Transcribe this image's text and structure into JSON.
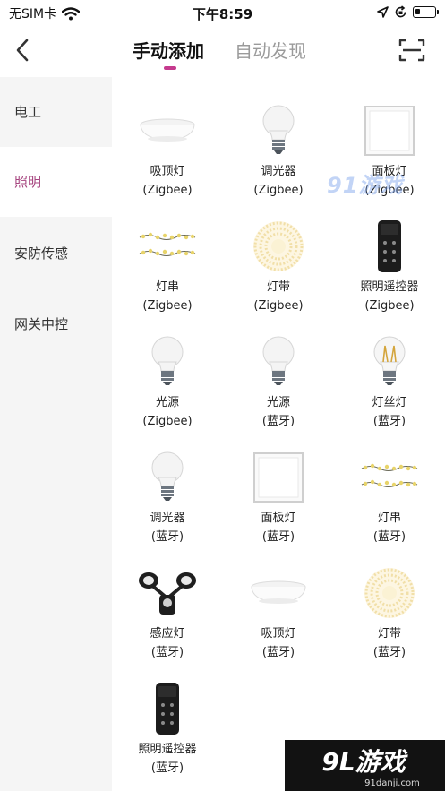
{
  "status_bar": {
    "carrier": "无SIM卡",
    "time": "下午8:59",
    "battery_level": 0.25
  },
  "nav": {
    "tabs": [
      {
        "label": "手动添加",
        "active": true
      },
      {
        "label": "自动发现",
        "active": false
      }
    ],
    "accent_color": "#c53a8e"
  },
  "sidebar": {
    "items": [
      {
        "label": "电工",
        "active": false
      },
      {
        "label": "照明",
        "active": true
      },
      {
        "label": "安防传感",
        "active": false
      },
      {
        "label": "网关中控",
        "active": false
      }
    ],
    "active_color": "#a6447f"
  },
  "devices": [
    {
      "name": "吸顶灯",
      "protocol": "(Zigbee)",
      "icon": "ceiling-light-icon"
    },
    {
      "name": "调光器",
      "protocol": "(Zigbee)",
      "icon": "bulb-icon"
    },
    {
      "name": "面板灯",
      "protocol": "(Zigbee)",
      "icon": "panel-light-icon"
    },
    {
      "name": "灯串",
      "protocol": "(Zigbee)",
      "icon": "string-light-icon"
    },
    {
      "name": "灯带",
      "protocol": "(Zigbee)",
      "icon": "light-strip-icon"
    },
    {
      "name": "照明遥控器",
      "protocol": "(Zigbee)",
      "icon": "remote-control-icon"
    },
    {
      "name": "光源",
      "protocol": "(Zigbee)",
      "icon": "bulb-icon"
    },
    {
      "name": "光源",
      "protocol": "(蓝牙)",
      "icon": "bulb-icon"
    },
    {
      "name": "灯丝灯",
      "protocol": "(蓝牙)",
      "icon": "filament-bulb-icon"
    },
    {
      "name": "调光器",
      "protocol": "(蓝牙)",
      "icon": "bulb-icon"
    },
    {
      "name": "面板灯",
      "protocol": "(蓝牙)",
      "icon": "panel-light-icon"
    },
    {
      "name": "灯串",
      "protocol": "(蓝牙)",
      "icon": "string-light-icon"
    },
    {
      "name": "感应灯",
      "protocol": "(蓝牙)",
      "icon": "motion-sensor-light-icon"
    },
    {
      "name": "吸顶灯",
      "protocol": "(蓝牙)",
      "icon": "ceiling-light-icon"
    },
    {
      "name": "灯带",
      "protocol": "(蓝牙)",
      "icon": "light-strip-icon"
    },
    {
      "name": "照明遥控器",
      "protocol": "(蓝牙)",
      "icon": "remote-control-icon"
    }
  ],
  "watermark": {
    "middle": "91游戏",
    "corner_logo": "9L游戏",
    "corner_url": "91danji.com"
  }
}
